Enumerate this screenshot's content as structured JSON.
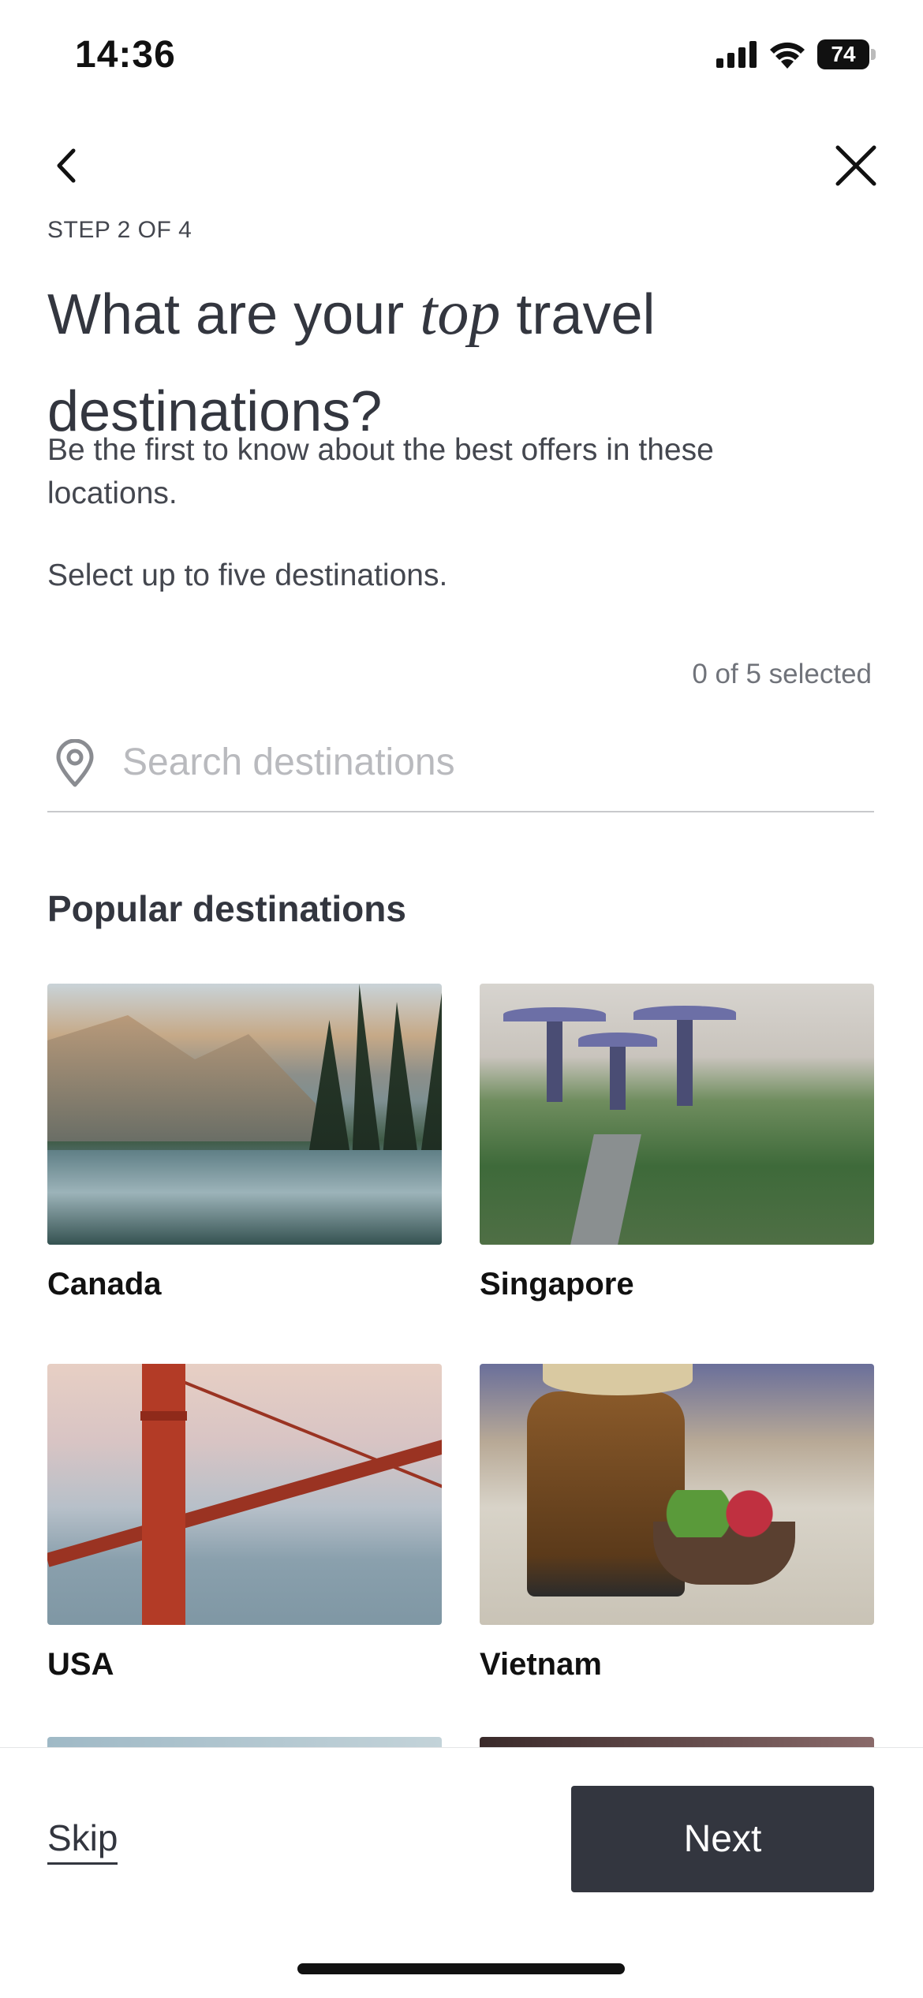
{
  "status_bar": {
    "time": "14:36",
    "battery": "74"
  },
  "header": {
    "step": "STEP 2 OF 4"
  },
  "headline": {
    "part1": "What are your ",
    "emphasis": "top",
    "part2": " travel",
    "line2": "destinations?"
  },
  "subtitle": "Be the first to know about the best offers in these locations.",
  "instruction": "Select up to five destinations.",
  "selection": {
    "count_text": "0 of 5 selected",
    "selected": 0,
    "max": 5
  },
  "search": {
    "placeholder": "Search destinations",
    "value": ""
  },
  "popular": {
    "title": "Popular destinations",
    "destinations": [
      {
        "name": "Canada"
      },
      {
        "name": "Singapore"
      },
      {
        "name": "USA"
      },
      {
        "name": "Vietnam"
      }
    ]
  },
  "footer": {
    "skip_label": "Skip",
    "next_label": "Next"
  },
  "colors": {
    "primary": "#33363f",
    "text": "#44474f",
    "muted": "#70737a",
    "divider": "#c8c9cc"
  },
  "icons": {
    "back": "chevron-left-icon",
    "close": "close-icon",
    "search": "map-pin-icon"
  }
}
